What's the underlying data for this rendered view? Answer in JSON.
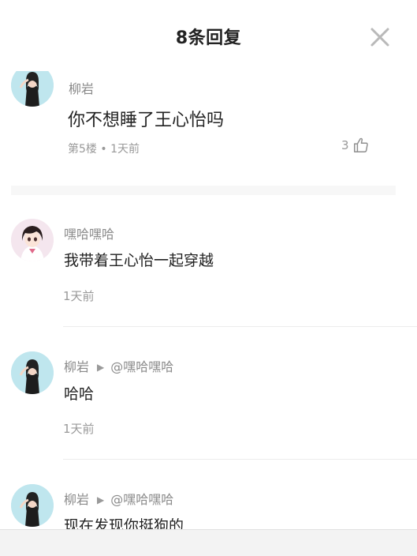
{
  "header": {
    "title": "8条回复",
    "close_icon": "close-icon"
  },
  "root_comment": {
    "author": "柳岩",
    "text": "你不想睡了王心怡吗",
    "meta": "第5楼 • 1天前",
    "likes": "3"
  },
  "replies": [
    {
      "author": "嘿哈嘿哈",
      "reply_to": "",
      "text": "我带着王心怡一起穿越",
      "time": "1天前"
    },
    {
      "author": "柳岩",
      "reply_to": "@嘿哈嘿哈",
      "text": "哈哈",
      "time": "1天前"
    },
    {
      "author": "柳岩",
      "reply_to": "@嘿哈嘿哈",
      "text": "现在发现你挺狗的",
      "time": ""
    }
  ],
  "colors": {
    "accent_text": "#222222",
    "muted": "#999999",
    "avatar_bg": "#bfe6ee",
    "avatar2_bg": "#f4e6ee"
  }
}
